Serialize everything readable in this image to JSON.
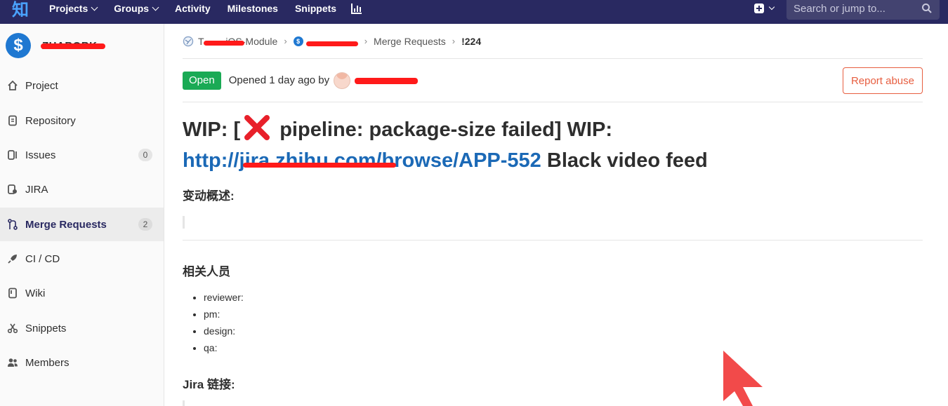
{
  "navbar": {
    "logo_glyph": "知",
    "items": [
      {
        "label": "Projects",
        "has_caret": true
      },
      {
        "label": "Groups",
        "has_caret": true
      },
      {
        "label": "Activity",
        "has_caret": false
      },
      {
        "label": "Milestones",
        "has_caret": false
      },
      {
        "label": "Snippets",
        "has_caret": false
      }
    ],
    "search_placeholder": "Search or jump to...",
    "bg_color": "#292961"
  },
  "sidebar": {
    "project_avatar_glyph": "$",
    "project_name": "ZHABOBK",
    "items": [
      {
        "label": "Project",
        "icon": "home-icon",
        "count": null,
        "active": false
      },
      {
        "label": "Repository",
        "icon": "document-icon",
        "count": null,
        "active": false
      },
      {
        "label": "Issues",
        "icon": "issues-icon",
        "count": "0",
        "active": false
      },
      {
        "label": "JIRA",
        "icon": "jira-icon",
        "count": null,
        "active": false
      },
      {
        "label": "Merge Requests",
        "icon": "merge-request-icon",
        "count": "2",
        "active": true
      },
      {
        "label": "CI / CD",
        "icon": "rocket-icon",
        "count": null,
        "active": false
      },
      {
        "label": "Wiki",
        "icon": "book-icon",
        "count": null,
        "active": false
      },
      {
        "label": "Snippets",
        "icon": "scissors-icon",
        "count": null,
        "active": false
      },
      {
        "label": "Members",
        "icon": "users-icon",
        "count": null,
        "active": false
      }
    ]
  },
  "breadcrumb": {
    "group": "T        iOS-Module",
    "project": "",
    "section": "Merge Requests",
    "current": "!224"
  },
  "merge_request": {
    "status": "Open",
    "opened_text": "Opened 1 day ago by",
    "author": "",
    "report_label": "Report abuse",
    "title_prefix": "WIP: [",
    "title_mid": " pipeline: package-size failed] WIP:",
    "title_link": "http://jira.zhihu.com/browse/APP-552",
    "title_suffix": " Black video feed",
    "desc_heading": "变动概述:",
    "people_heading": "相关人员",
    "people": [
      "reviewer:",
      "pm:",
      "design:",
      "qa:"
    ],
    "jira_heading": "Jira 链接:"
  },
  "colors": {
    "accent": "#292961",
    "open_badge": "#1aaa55",
    "report": "#e75e40",
    "link": "#1b69b6",
    "redaction": "#ff1a1a"
  }
}
